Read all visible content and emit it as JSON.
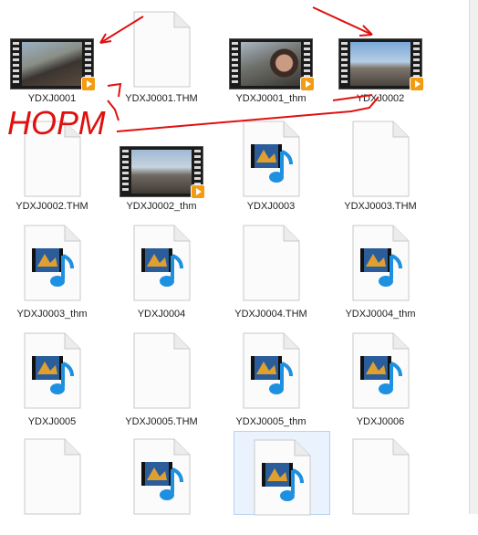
{
  "files": [
    {
      "name": "YDXJ0001",
      "icon": "video-thumbnail"
    },
    {
      "name": "YDXJ0001.THM",
      "icon": "blank-file-icon"
    },
    {
      "name": "YDXJ0001_thm",
      "icon": "video-thumbnail"
    },
    {
      "name": "YDXJ0002",
      "icon": "video-thumbnail"
    },
    {
      "name": "YDXJ0002.THM",
      "icon": "blank-file-icon"
    },
    {
      "name": "YDXJ0002_thm",
      "icon": "video-thumbnail"
    },
    {
      "name": "YDXJ0003",
      "icon": "media-file-icon"
    },
    {
      "name": "YDXJ0003.THM",
      "icon": "blank-file-icon"
    },
    {
      "name": "YDXJ0003_thm",
      "icon": "media-file-icon"
    },
    {
      "name": "YDXJ0004",
      "icon": "media-file-icon"
    },
    {
      "name": "YDXJ0004.THM",
      "icon": "blank-file-icon"
    },
    {
      "name": "YDXJ0004_thm",
      "icon": "media-file-icon"
    },
    {
      "name": "YDXJ0005",
      "icon": "media-file-icon"
    },
    {
      "name": "YDXJ0005.THM",
      "icon": "blank-file-icon"
    },
    {
      "name": "YDXJ0005_thm",
      "icon": "media-file-icon"
    },
    {
      "name": "YDXJ0006",
      "icon": "media-file-icon"
    },
    {
      "name": "",
      "icon": "blank-file-icon"
    },
    {
      "name": "",
      "icon": "media-file-icon"
    },
    {
      "name": "",
      "icon": "media-file-icon",
      "selected": true
    },
    {
      "name": "",
      "icon": "blank-file-icon"
    }
  ],
  "annotation": {
    "text": "НОРМ",
    "color": "#e01010"
  }
}
